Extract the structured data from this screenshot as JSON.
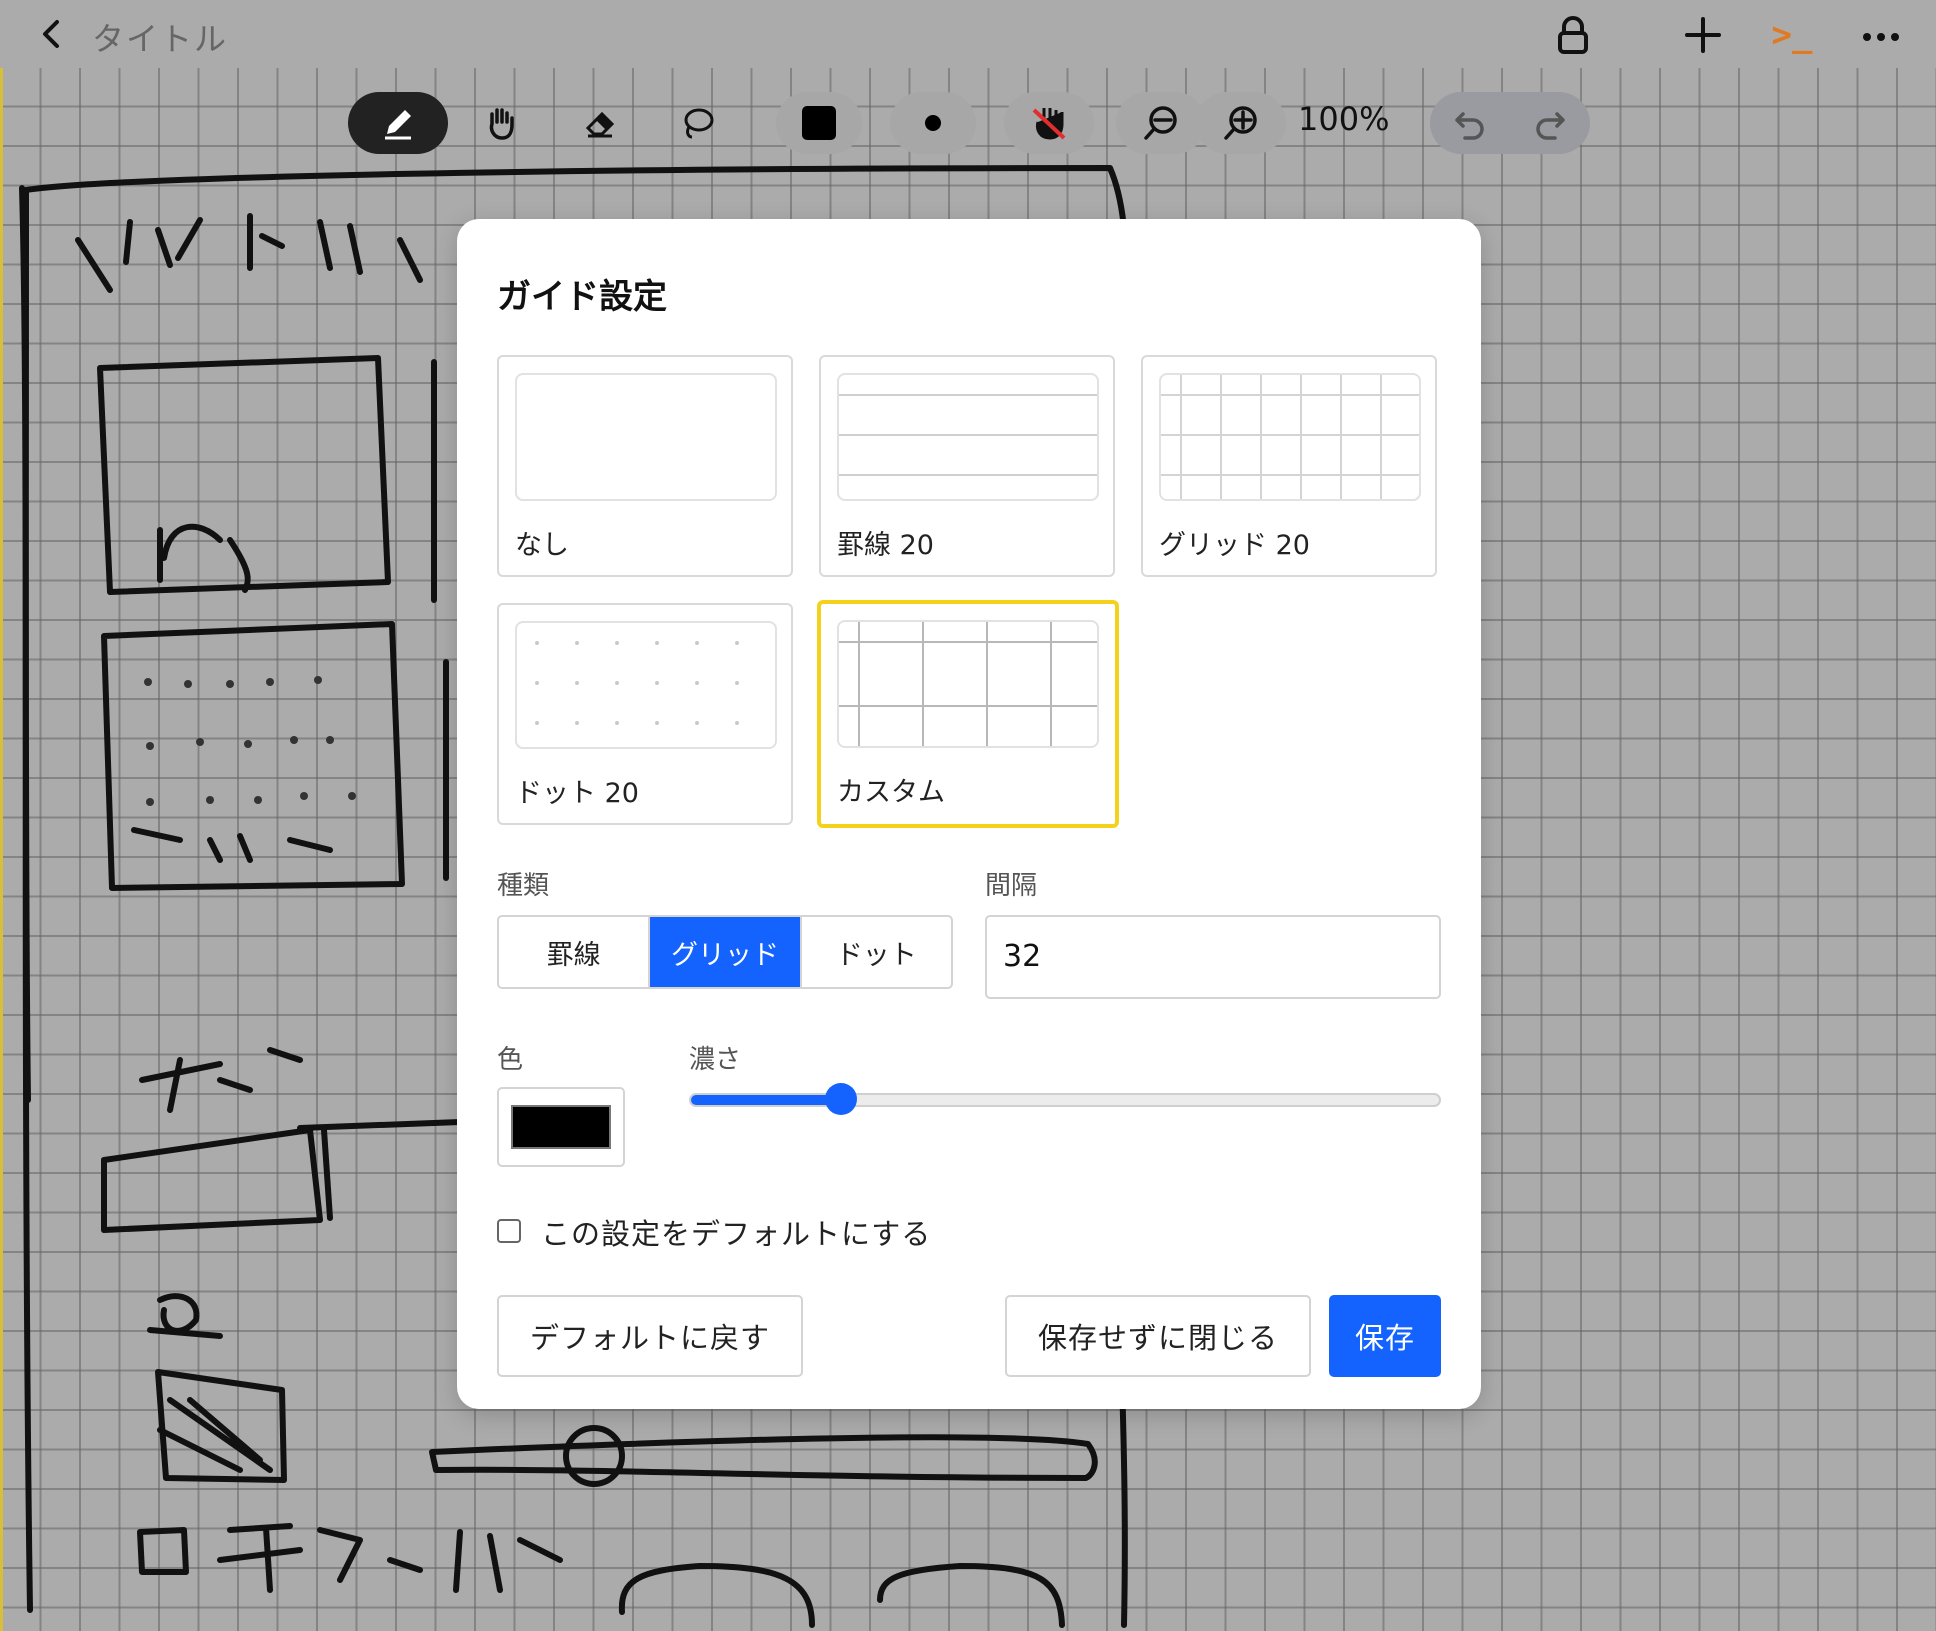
{
  "header": {
    "title": "タイトル",
    "console_label": ">_"
  },
  "toolbar": {
    "zoom_level": "100%"
  },
  "dialog": {
    "title": "ガイド設定",
    "presets": [
      {
        "label": "なし"
      },
      {
        "label": "罫線 20"
      },
      {
        "label": "グリッド 20"
      },
      {
        "label": "ドット 20"
      },
      {
        "label": "カスタム"
      }
    ],
    "type_label": "種類",
    "type_options": [
      "罫線",
      "グリッド",
      "ドット"
    ],
    "type_selected": "グリッド",
    "interval_label": "間隔",
    "interval_value": "32",
    "color_label": "色",
    "color_value": "#000000",
    "opacity_label": "濃さ",
    "opacity_value": 0.2,
    "default_checkbox_label": "この設定をデフォルトにする",
    "default_checked": false,
    "reset_button": "デフォルトに戻す",
    "close_button": "保存せずに閉じる",
    "save_button": "保存"
  },
  "colors": {
    "accent": "#1463ff",
    "selected_border": "#f4d21c",
    "console_icon": "#e07a22"
  }
}
